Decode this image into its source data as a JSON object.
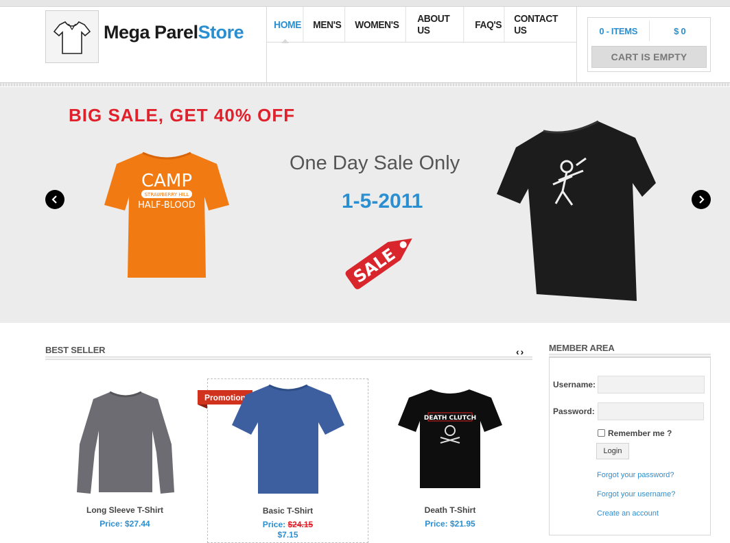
{
  "header": {
    "logo_main": "Mega Parel",
    "logo_accent": "Store",
    "nav": [
      "HOME",
      "MEN'S",
      "WOMEN'S",
      "ABOUT US",
      "FAQ'S",
      "CONTACT US"
    ],
    "active_nav": "HOME"
  },
  "cart": {
    "items_label": "0 - ITEMS",
    "total_label": "$ 0",
    "status": "CART IS EMPTY"
  },
  "banner": {
    "headline": "BIG SALE, GET 40% OFF",
    "subheadline": "One Day Sale Only",
    "date": "1-5-2011",
    "tag_text": "SALE",
    "left_shirt_text_1": "CAMP",
    "left_shirt_text_2": "HALF-BLOOD",
    "left_shirt_text_small": "STRAWBERRY HILL"
  },
  "best_seller": {
    "title": "BEST SELLER",
    "promotion_label": "Promotion",
    "products": [
      {
        "name": "Long Sleeve T-Shirt",
        "price": "Price: $27.44"
      },
      {
        "name": "Basic T-Shirt",
        "price_prefix": "Price:",
        "old_price": "$24.15",
        "new_price": "$7.15"
      },
      {
        "name": "Death T-Shirt",
        "price": "Price: $21.95",
        "shirt_text": "DEATH CLUTCH"
      }
    ]
  },
  "member": {
    "title": "MEMBER AREA",
    "username_label": "Username:",
    "password_label": "Password:",
    "remember_label": "Remember me ?",
    "login_label": "Login",
    "forgot_password": "Forgot your password?",
    "forgot_username": "Forgot your username?",
    "create_account": "Create an account"
  },
  "colors": {
    "accent": "#2a8fd0",
    "sale_red": "#e0202a",
    "promo_red": "#d1321e"
  }
}
